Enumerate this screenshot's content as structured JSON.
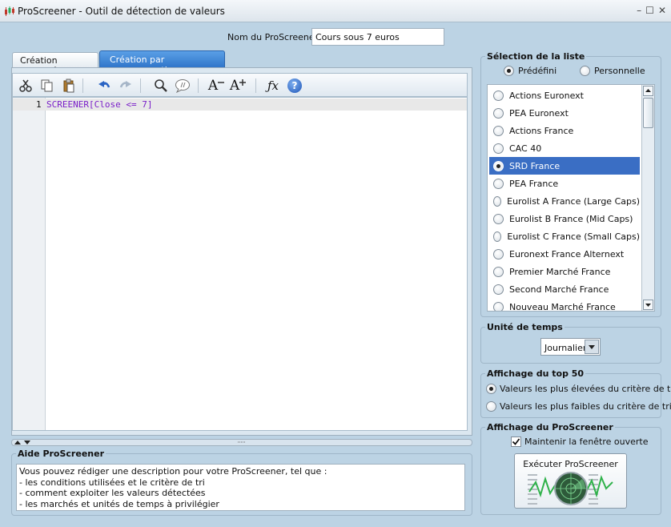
{
  "window": {
    "title": "ProScreener - Outil de détection de valeurs",
    "controls": {
      "minimize": "–",
      "maximize": "☐",
      "close": "✕"
    }
  },
  "header": {
    "name_label": "Nom du ProScreener",
    "name_value": "Cours sous 7 euros"
  },
  "tabs": [
    {
      "label": "Création simplifiée",
      "active": false
    },
    {
      "label": "Création par programmation",
      "active": true
    }
  ],
  "toolbar": {
    "buttons": [
      "cut-icon",
      "copy-icon",
      "paste-icon",
      "undo-icon",
      "redo-icon",
      "search-icon",
      "comment-icon",
      "font-decrease-icon",
      "font-increase-icon",
      "function-icon",
      "help-icon"
    ],
    "font_glyph": "A",
    "fx_glyph": "ƒx",
    "help_glyph": "?"
  },
  "editor": {
    "line_number": "1",
    "code": "SCREENER[Close <= 7]"
  },
  "help": {
    "title": "Aide ProScreener",
    "lines": [
      "Vous pouvez rédiger une description pour votre ProScreener, tel que :",
      "- les conditions utilisées et le critère de tri",
      "- comment exploiter les valeurs détectées",
      "- les marchés et unités de temps à privilégier"
    ]
  },
  "list_selection": {
    "title": "Sélection de la liste",
    "modes": [
      {
        "label": "Prédéfini",
        "selected": true
      },
      {
        "label": "Personnelle",
        "selected": false
      }
    ],
    "items": [
      {
        "label": "Actions Euronext",
        "selected": false
      },
      {
        "label": "PEA Euronext",
        "selected": false
      },
      {
        "label": "Actions France",
        "selected": false
      },
      {
        "label": "CAC 40",
        "selected": false
      },
      {
        "label": "SRD France",
        "selected": true
      },
      {
        "label": "PEA France",
        "selected": false
      },
      {
        "label": "Eurolist A France (Large Caps)",
        "selected": false
      },
      {
        "label": "Eurolist B France (Mid Caps)",
        "selected": false
      },
      {
        "label": "Eurolist C France (Small Caps)",
        "selected": false
      },
      {
        "label": "Euronext France Alternext",
        "selected": false
      },
      {
        "label": "Premier Marché France",
        "selected": false
      },
      {
        "label": "Second Marché France",
        "selected": false
      },
      {
        "label": "Nouveau Marché France",
        "selected": false
      }
    ]
  },
  "time_unit": {
    "title": "Unité de temps",
    "value": "Journalier"
  },
  "top50": {
    "title": "Affichage du top 50",
    "options": [
      {
        "label": "Valeurs les plus élevées du critère de tri",
        "selected": true
      },
      {
        "label": "Valeurs les plus faibles du critère de tri",
        "selected": false
      }
    ]
  },
  "display": {
    "title": "Affichage du ProScreener",
    "keep_open_label": "Maintenir la fenêtre ouverte",
    "keep_open_checked": true,
    "execute_label": "Exécuter ProScreener"
  },
  "colors": {
    "accent": "#3a6ec4",
    "tab_active": "#3b82d6",
    "code": "#7a1fc9",
    "background": "#bcd3e4"
  }
}
